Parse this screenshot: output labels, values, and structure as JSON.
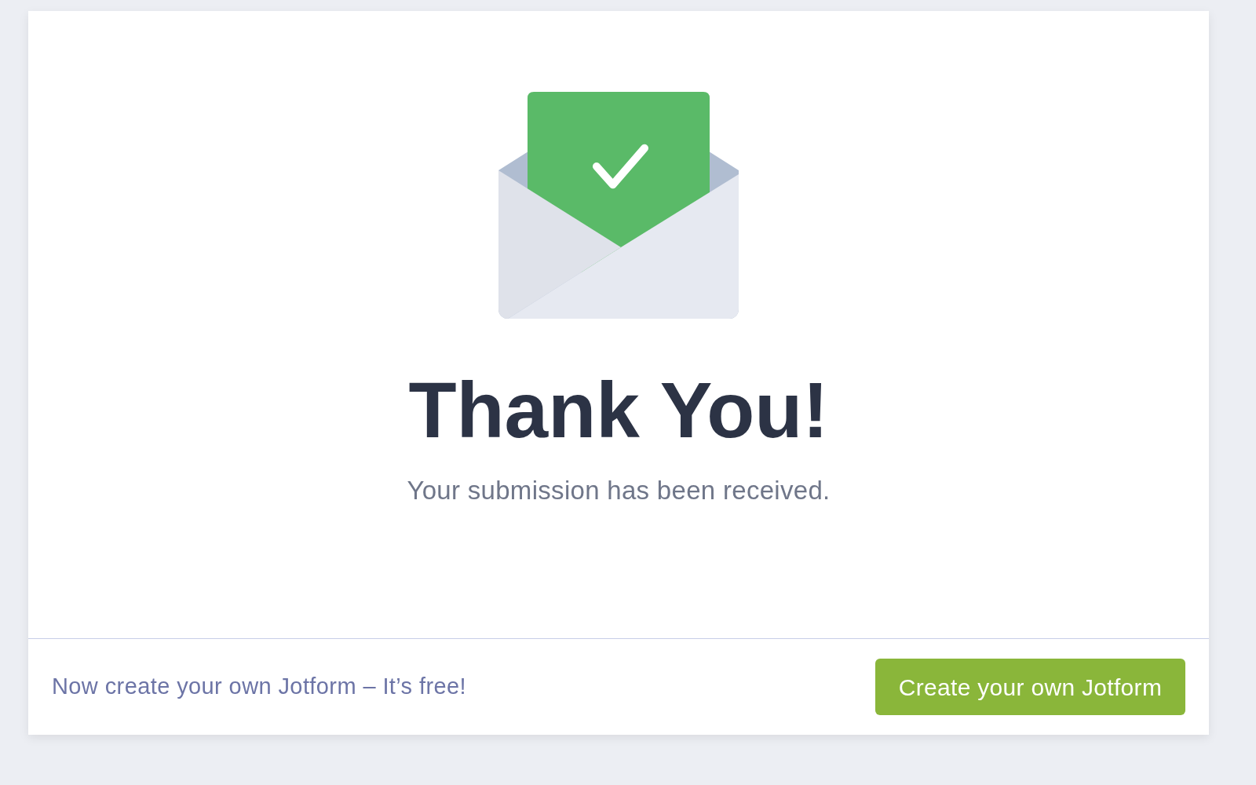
{
  "confirmation": {
    "title": "Thank You!",
    "message": "Your submission has been received."
  },
  "footer": {
    "promo_text": "Now create your own Jotform – It’s free!",
    "button": "Create your own Jotform"
  }
}
